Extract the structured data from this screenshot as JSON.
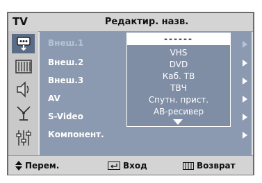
{
  "header": {
    "tv_label": "TV",
    "title": "Редактир. назв."
  },
  "sidebar": {
    "icons": [
      "input-icon",
      "picture-icon",
      "sound-icon",
      "channel-icon",
      "setup-icon"
    ],
    "active_index": 0
  },
  "menu": {
    "rows": [
      {
        "label": "Внеш.1",
        "dimmed": true
      },
      {
        "label": "Внеш.2",
        "dimmed": false
      },
      {
        "label": "Внеш.3",
        "dimmed": false
      },
      {
        "label": "AV",
        "dimmed": false
      },
      {
        "label": "S-Video",
        "dimmed": false
      },
      {
        "label": "Компонент.",
        "dimmed": false
      }
    ]
  },
  "dropdown": {
    "selected": "------",
    "options": [
      "VHS",
      "DVD",
      "Каб. ТВ",
      "ТВЧ",
      "Спутн. прист.",
      "АВ-ресивер"
    ]
  },
  "footer": {
    "move": "Перем.",
    "enter": "Вход",
    "return": "Возврат"
  },
  "colors": {
    "panel": "#8b9ab0",
    "active_icon_bg": "#5b6d86",
    "frame": "#e4e4e4"
  }
}
